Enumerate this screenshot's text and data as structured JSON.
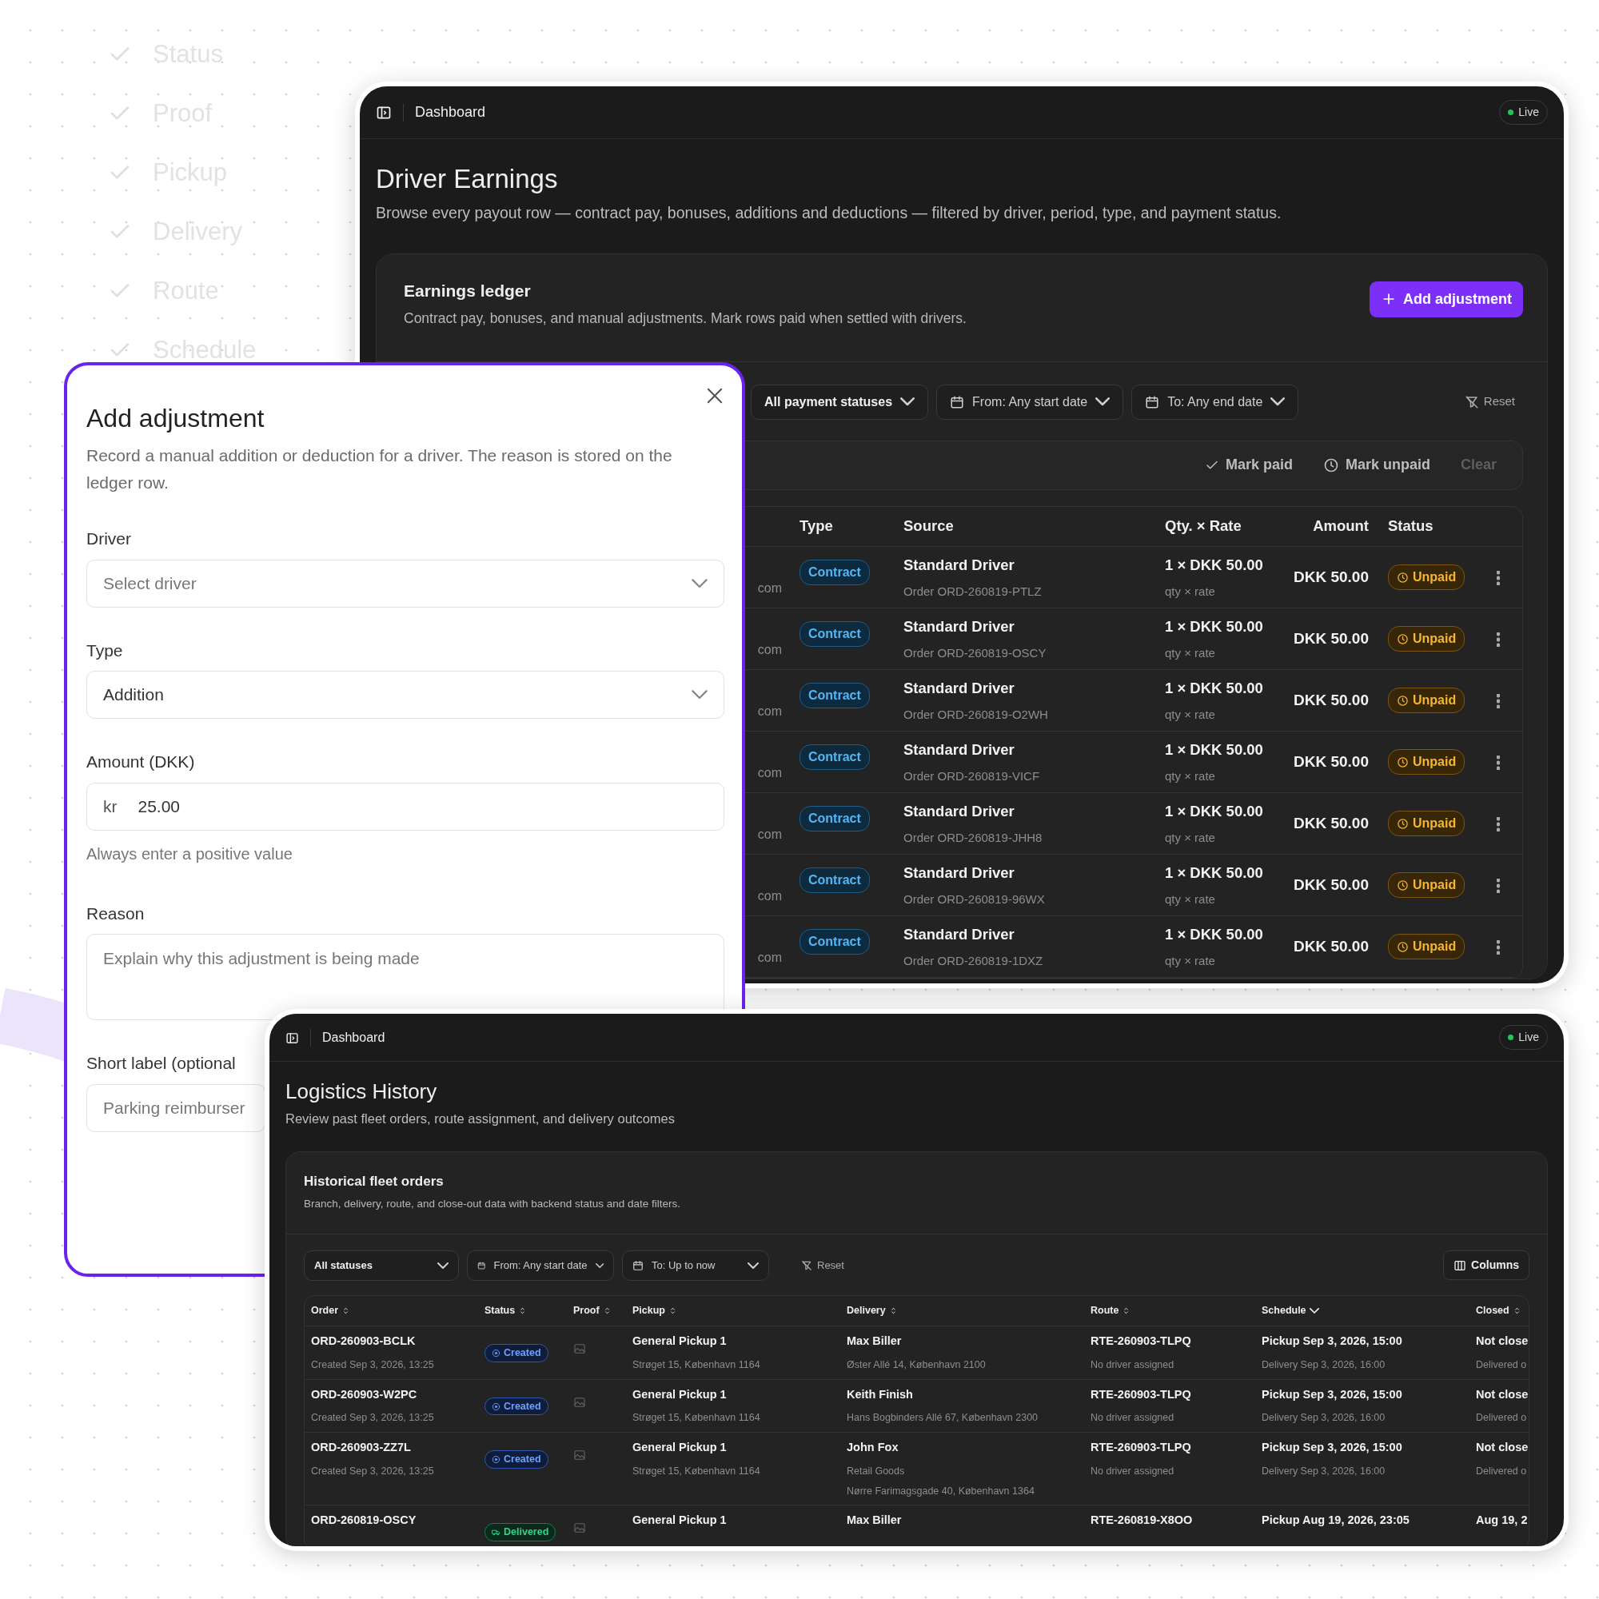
{
  "checklist": [
    {
      "label": "Status",
      "checked": true
    },
    {
      "label": "Proof",
      "checked": true
    },
    {
      "label": "Pickup",
      "checked": true
    },
    {
      "label": "Delivery",
      "checked": true
    },
    {
      "label": "Route",
      "checked": true
    },
    {
      "label": "Schedule",
      "checked": true
    }
  ],
  "earnings_window": {
    "topbar": {
      "title": "Dashboard",
      "status": "Live"
    },
    "heading": "Driver Earnings",
    "subtitle": "Browse every payout row — contract pay, bonuses, additions and deductions — filtered by driver, period, type, and payment status.",
    "ledger": {
      "title": "Earnings ledger",
      "subtitle": "Contract pay, bonuses, and manual adjustments. Mark rows paid when settled with drivers.",
      "add_button": "Add adjustment"
    },
    "filters": [
      {
        "kind": "select",
        "label": "All payment statuses"
      },
      {
        "kind": "date",
        "label": "From: Any start date"
      },
      {
        "kind": "date",
        "label": "To: Any end date"
      }
    ],
    "reset": "Reset",
    "bulk_actions": [
      {
        "kind": "paid",
        "label": "Mark paid",
        "disabled": false
      },
      {
        "kind": "unpaid",
        "label": "Mark unpaid",
        "disabled": false
      },
      {
        "kind": "clear",
        "label": "Clear",
        "disabled": true
      }
    ],
    "table": {
      "columns": [
        "Type",
        "Source",
        "Qty. × Rate",
        "Amount",
        "Status"
      ],
      "rows": [
        {
          "column_1": "com",
          "type": "Contract",
          "source": "Standard Driver",
          "order": "Order ORD-260819-PTLZ",
          "qty_rate": "1 × DKK 50.00",
          "qty_note": "qty × rate",
          "amount": "DKK 50.00",
          "status": "Unpaid"
        },
        {
          "column_1": "com",
          "type": "Contract",
          "source": "Standard Driver",
          "order": "Order ORD-260819-OSCY",
          "qty_rate": "1 × DKK 50.00",
          "qty_note": "qty × rate",
          "amount": "DKK 50.00",
          "status": "Unpaid"
        },
        {
          "column_1": "com",
          "type": "Contract",
          "source": "Standard Driver",
          "order": "Order ORD-260819-O2WH",
          "qty_rate": "1 × DKK 50.00",
          "qty_note": "qty × rate",
          "amount": "DKK 50.00",
          "status": "Unpaid"
        },
        {
          "column_1": "com",
          "type": "Contract",
          "source": "Standard Driver",
          "order": "Order ORD-260819-VICF",
          "qty_rate": "1 × DKK 50.00",
          "qty_note": "qty × rate",
          "amount": "DKK 50.00",
          "status": "Unpaid"
        },
        {
          "column_1": "com",
          "type": "Contract",
          "source": "Standard Driver",
          "order": "Order ORD-260819-JHH8",
          "qty_rate": "1 × DKK 50.00",
          "qty_note": "qty × rate",
          "amount": "DKK 50.00",
          "status": "Unpaid"
        },
        {
          "column_1": "com",
          "type": "Contract",
          "source": "Standard Driver",
          "order": "Order ORD-260819-96WX",
          "qty_rate": "1 × DKK 50.00",
          "qty_note": "qty × rate",
          "amount": "DKK 50.00",
          "status": "Unpaid"
        },
        {
          "column_1": "com",
          "type": "Contract",
          "source": "Standard Driver",
          "order": "Order ORD-260819-1DXZ",
          "qty_rate": "1 × DKK 50.00",
          "qty_note": "qty × rate",
          "amount": "DKK 50.00",
          "status": "Unpaid"
        }
      ]
    }
  },
  "adjustment_dialog": {
    "title": "Add adjustment",
    "description": "Record a manual addition or deduction for a driver. The reason is stored on the ledger row.",
    "fields": [
      {
        "kind": "select",
        "label": "Driver",
        "placeholder": "Select driver"
      },
      {
        "kind": "select",
        "label": "Type",
        "value": "Addition"
      },
      {
        "kind": "amount",
        "label": "Amount (DKK)",
        "prefix": "kr",
        "value": "25.00",
        "hint": "Always enter a positive value"
      },
      {
        "kind": "textarea",
        "label": "Reason",
        "placeholder": "Explain why this adjustment is being made"
      },
      {
        "kind": "text",
        "label": "Short label (optional",
        "placeholder": "Parking reimburser"
      }
    ]
  },
  "logistics_window": {
    "topbar": {
      "title": "Dashboard",
      "status": "Live"
    },
    "heading": "Logistics History",
    "subtitle": "Review past fleet orders, route assignment, and delivery outcomes",
    "card": {
      "title": "Historical fleet orders",
      "subtitle": "Branch, delivery, route, and close-out data with backend status and date filters."
    },
    "filters": [
      {
        "kind": "select",
        "label": "All statuses"
      },
      {
        "kind": "date",
        "label": "From: Any start date"
      },
      {
        "kind": "date",
        "label": "To: Up to now"
      }
    ],
    "reset": "Reset",
    "columns_button": "Columns",
    "table": {
      "columns": [
        {
          "label": "Order",
          "sorted": false
        },
        {
          "label": "Status",
          "sorted": false
        },
        {
          "label": "Proof",
          "sorted": false
        },
        {
          "label": "Pickup",
          "sorted": false
        },
        {
          "label": "Delivery",
          "sorted": false
        },
        {
          "label": "Route",
          "sorted": false
        },
        {
          "label": "Schedule",
          "sorted": true
        },
        {
          "label": "Closed",
          "sorted": false
        }
      ],
      "rows": [
        {
          "order": "ORD-260903-BCLK",
          "created": "Created Sep 3, 2026, 13:25",
          "status": {
            "kind": "created",
            "label": "Created"
          },
          "pickup": [
            "General Pickup 1",
            "Strøget 15, København 1164"
          ],
          "delivery": [
            "Max Biller",
            "Øster Allé 14, København 2100"
          ],
          "route": [
            "RTE-260903-TLPQ",
            "No driver assigned"
          ],
          "schedule": [
            "Pickup Sep 3, 2026, 15:00",
            "Delivery Sep 3, 2026, 16:00"
          ],
          "closed": [
            "Not close",
            "Delivered o"
          ]
        },
        {
          "order": "ORD-260903-W2PC",
          "created": "Created Sep 3, 2026, 13:25",
          "status": {
            "kind": "created",
            "label": "Created"
          },
          "pickup": [
            "General Pickup 1",
            "Strøget 15, København 1164"
          ],
          "delivery": [
            "Keith Finish",
            "Hans Bogbinders Allé 67, København 2300"
          ],
          "route": [
            "RTE-260903-TLPQ",
            "No driver assigned"
          ],
          "schedule": [
            "Pickup Sep 3, 2026, 15:00",
            "Delivery Sep 3, 2026, 16:00"
          ],
          "closed": [
            "Not close",
            "Delivered o"
          ]
        },
        {
          "order": "ORD-260903-ZZ7L",
          "created": "Created Sep 3, 2026, 13:25",
          "status": {
            "kind": "created",
            "label": "Created"
          },
          "pickup": [
            "General Pickup 1",
            "Strøget 15, København 1164"
          ],
          "delivery": [
            "John Fox",
            "Retail Goods",
            "Nørre Farimagsgade 40, København 1364"
          ],
          "route": [
            "RTE-260903-TLPQ",
            "No driver assigned"
          ],
          "schedule": [
            "Pickup Sep 3, 2026, 15:00",
            "Delivery Sep 3, 2026, 16:00"
          ],
          "closed": [
            "Not close",
            "Delivered o"
          ]
        },
        {
          "order": "ORD-260819-OSCY",
          "status": {
            "kind": "delivered",
            "label": "Delivered"
          },
          "pickup": [
            "General Pickup 1"
          ],
          "delivery": [
            "Max Biller"
          ],
          "route": [
            "RTE-260819-X8OO"
          ],
          "schedule": [
            "Pickup Aug 19, 2026, 23:05"
          ],
          "closed": [
            "Aug 19, 2"
          ]
        }
      ]
    }
  }
}
